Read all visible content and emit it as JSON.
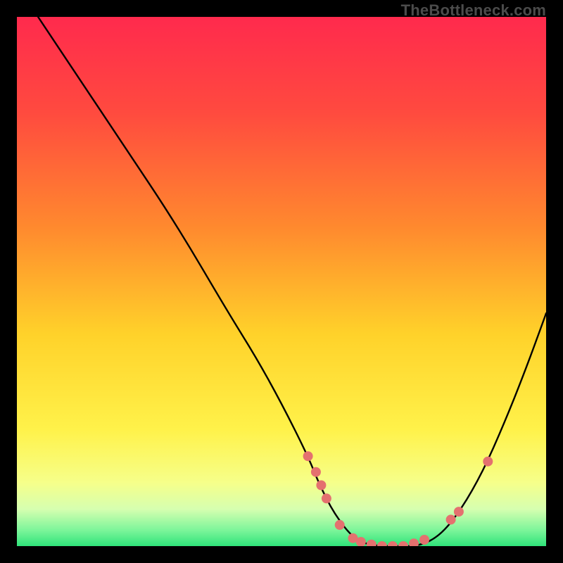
{
  "watermark": "TheBottleneck.com",
  "colors": {
    "background": "#000000",
    "gradient_stops": [
      {
        "offset": 0.0,
        "color": "#ff2a4d"
      },
      {
        "offset": 0.18,
        "color": "#ff4a3f"
      },
      {
        "offset": 0.4,
        "color": "#ff8a2e"
      },
      {
        "offset": 0.6,
        "color": "#ffd22a"
      },
      {
        "offset": 0.78,
        "color": "#fff24a"
      },
      {
        "offset": 0.88,
        "color": "#f6ff8a"
      },
      {
        "offset": 0.93,
        "color": "#d6ffb0"
      },
      {
        "offset": 0.97,
        "color": "#7cf59a"
      },
      {
        "offset": 1.0,
        "color": "#2fe37a"
      }
    ],
    "curve": "#000000",
    "dots": "#e4716f"
  },
  "chart_data": {
    "type": "line",
    "title": "",
    "xlabel": "",
    "ylabel": "",
    "xlim": [
      0,
      100
    ],
    "ylim": [
      0,
      100
    ],
    "grid": false,
    "legend": false,
    "series": [
      {
        "name": "bottleneck-curve",
        "x": [
          4,
          10,
          20,
          30,
          40,
          45,
          50,
          55,
          57,
          60,
          64,
          68,
          72,
          76,
          80,
          84,
          88,
          92,
          96,
          100
        ],
        "y": [
          100,
          91,
          76,
          61,
          44,
          36,
          27,
          17,
          12,
          6,
          1,
          0,
          0,
          0,
          2,
          7,
          14,
          23,
          33,
          44
        ]
      }
    ],
    "markers": {
      "name": "dots",
      "points": [
        {
          "x": 55.0,
          "y": 17.0
        },
        {
          "x": 56.5,
          "y": 14.0
        },
        {
          "x": 57.5,
          "y": 11.5
        },
        {
          "x": 58.5,
          "y": 9.0
        },
        {
          "x": 61.0,
          "y": 4.0
        },
        {
          "x": 63.5,
          "y": 1.5
        },
        {
          "x": 65.0,
          "y": 0.8
        },
        {
          "x": 67.0,
          "y": 0.3
        },
        {
          "x": 69.0,
          "y": 0.0
        },
        {
          "x": 71.0,
          "y": 0.0
        },
        {
          "x": 73.0,
          "y": 0.0
        },
        {
          "x": 75.0,
          "y": 0.5
        },
        {
          "x": 77.0,
          "y": 1.2
        },
        {
          "x": 82.0,
          "y": 5.0
        },
        {
          "x": 83.5,
          "y": 6.5
        },
        {
          "x": 89.0,
          "y": 16.0
        }
      ],
      "radius": 7
    }
  }
}
